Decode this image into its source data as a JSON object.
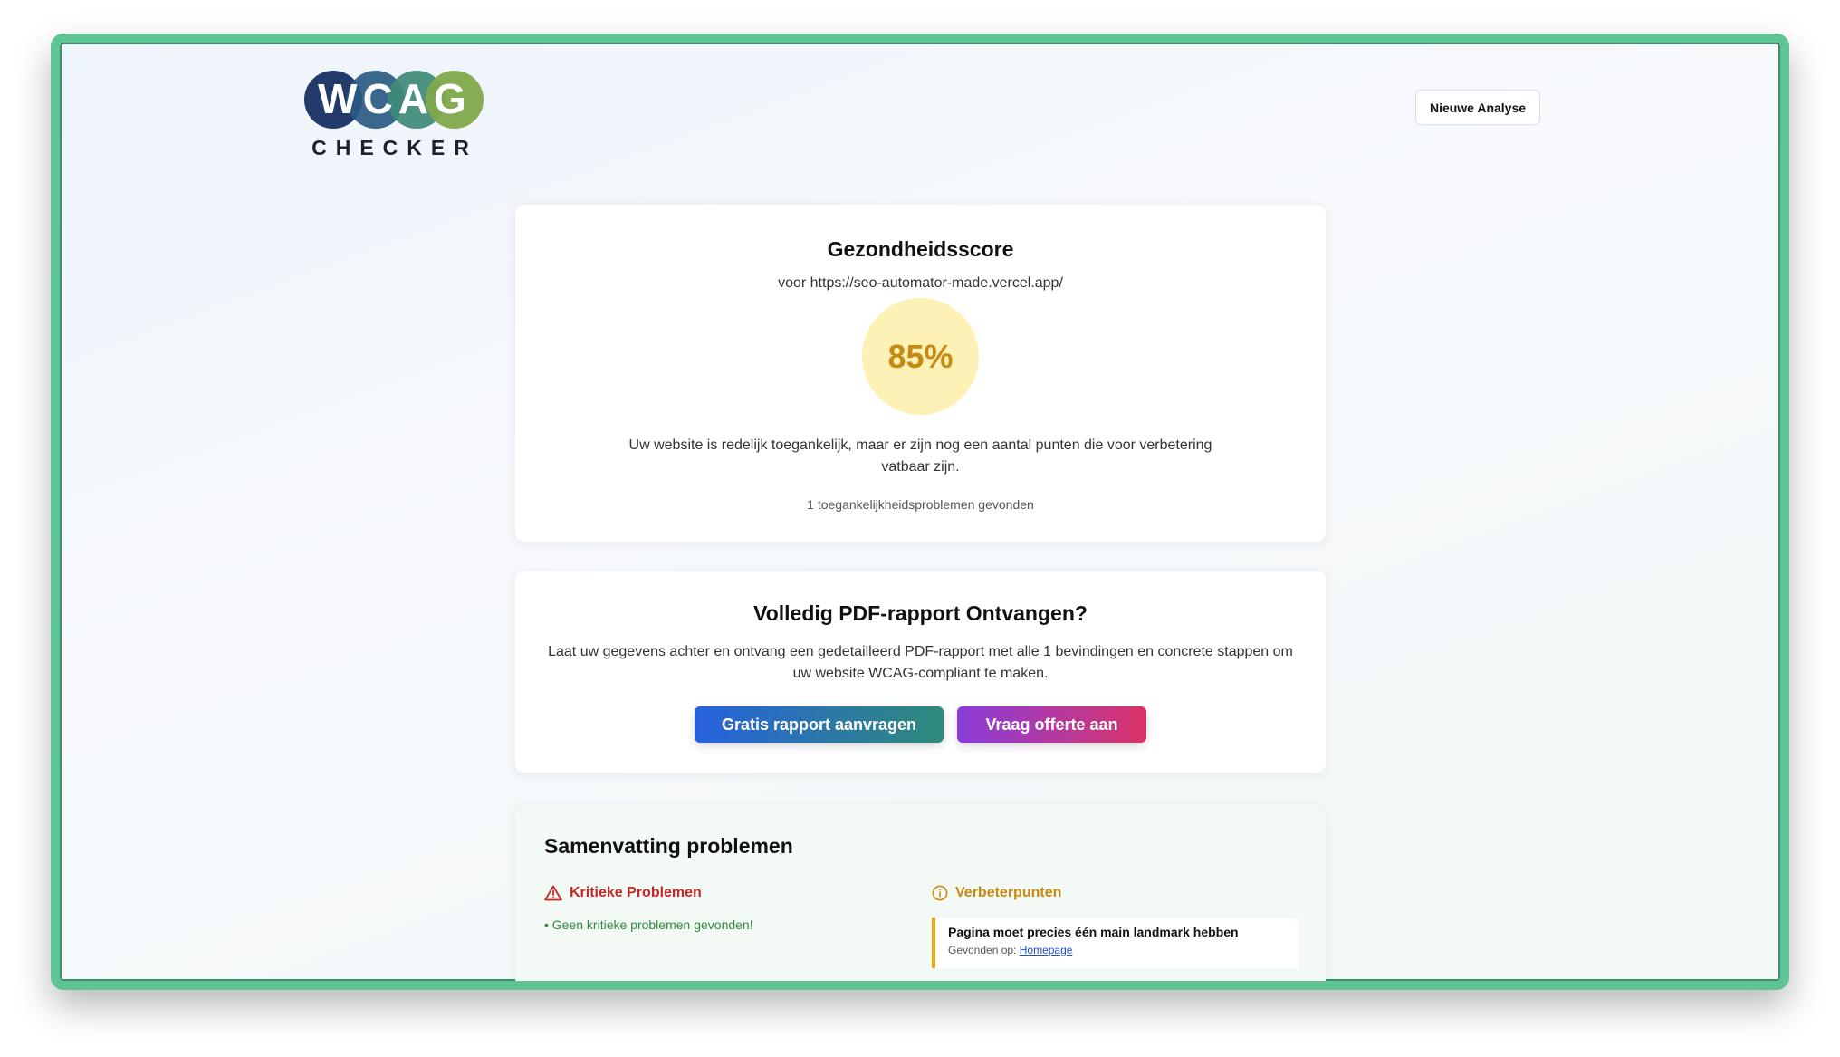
{
  "header": {
    "logo_top": "WCAG",
    "logo_bottom": "CHECKER",
    "new_analysis_label": "Nieuwe Analyse"
  },
  "score_card": {
    "title": "Gezondheidsscore",
    "url_line": "voor https://seo-automator-made.vercel.app/",
    "score": "85%",
    "description": "Uw website is redelijk toegankelijk, maar er zijn nog een aantal punten die voor verbetering vatbaar zijn.",
    "issue_count": "1 toegankelijkheidsproblemen gevonden"
  },
  "report_card": {
    "title": "Volledig PDF-rapport Ontvangen?",
    "description": "Laat uw gegevens achter en ontvang een gedetailleerd PDF-rapport met alle 1 bevindingen en concrete stappen om uw website WCAG-compliant te maken.",
    "free_report_label": "Gratis rapport aanvragen",
    "quote_label": "Vraag offerte aan"
  },
  "summary": {
    "title": "Samenvatting problemen",
    "critical_heading": "Kritieke Problemen",
    "critical_none": "• Geen kritieke problemen gevonden!",
    "improvements_heading": "Verbeterpunten",
    "improvements": [
      {
        "title": "Pagina moet precies één main landmark hebben",
        "found_label": "Gevonden op:",
        "found_link": "Homepage"
      }
    ]
  },
  "colors": {
    "frame": "#5ec495",
    "score_bg": "#fdf1b5",
    "score_text": "#c68a12",
    "critical": "#c62828",
    "improvement": "#c68a12"
  }
}
